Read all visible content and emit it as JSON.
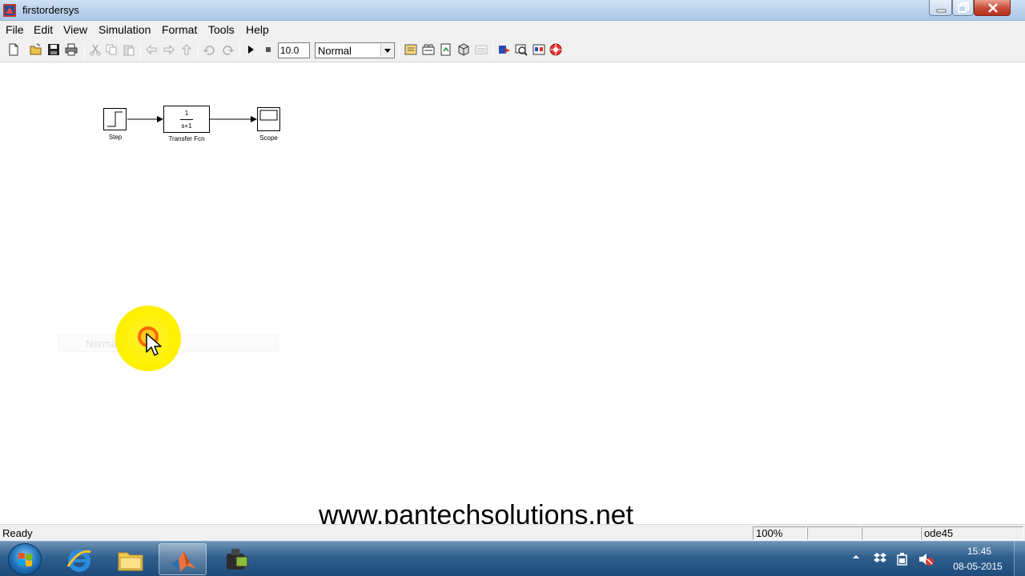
{
  "window": {
    "title": "firstordersys"
  },
  "menu": {
    "items": [
      "File",
      "Edit",
      "View",
      "Simulation",
      "Format",
      "Tools",
      "Help"
    ]
  },
  "toolbar": {
    "icons": [
      "new-model-icon",
      "open-icon",
      "save-icon",
      "print-icon",
      "cut-icon",
      "copy-icon",
      "paste-icon",
      "back-icon",
      "forward-icon",
      "up-icon",
      "undo-icon",
      "redo-icon",
      "start-simulation-icon",
      "stop-simulation-icon",
      "model-explorer-icon",
      "library-browser-icon",
      "debugger-icon",
      "model-advisor-icon",
      "properties-icon"
    ],
    "stop_time": "10.0",
    "sim_mode": "Normal"
  },
  "model": {
    "blocks": [
      {
        "id": "step",
        "label": "Step"
      },
      {
        "id": "transfer-fcn",
        "label": "Transfer Fcn",
        "numerator": "1",
        "denominator": "s+1"
      },
      {
        "id": "scope",
        "label": "Scope"
      }
    ],
    "tooltip_ghost": "Normal (10.0)"
  },
  "watermark": "www.pantechsolutions.net",
  "status": {
    "text": "Ready",
    "zoom": "100%",
    "solver": "ode45"
  },
  "taskbar": {
    "apps": [
      "internet-explorer-icon",
      "file-explorer-icon",
      "matlab-icon",
      "camera-recorder-icon"
    ],
    "time": "15:45",
    "date": "08-05-2015"
  }
}
